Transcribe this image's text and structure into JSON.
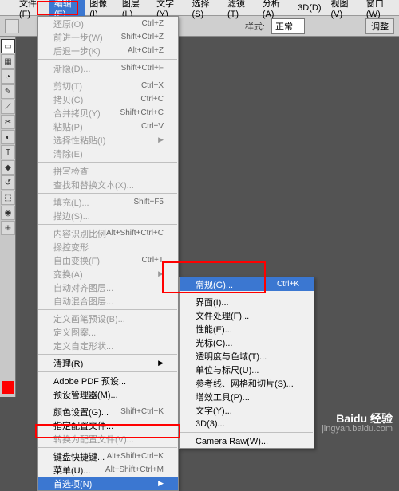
{
  "menubar": {
    "items": [
      "文件(F)",
      "编辑(E)",
      "图像(I)",
      "图层(L)",
      "文字(Y)",
      "选择(S)",
      "滤镜(T)",
      "分析(A)",
      "3D(D)",
      "视图(V)",
      "窗口(W)"
    ],
    "active_index": 1
  },
  "toolbar": {
    "label_style": "样式:",
    "style_value": "正常",
    "adjust_btn": "调整"
  },
  "edit_menu": {
    "items": [
      {
        "label": "还原(O)",
        "sc": "Ctrl+Z",
        "disabled": true
      },
      {
        "label": "前进一步(W)",
        "sc": "Shift+Ctrl+Z",
        "disabled": true
      },
      {
        "label": "后退一步(K)",
        "sc": "Alt+Ctrl+Z",
        "disabled": true
      },
      {
        "sep": true
      },
      {
        "label": "渐隐(D)...",
        "sc": "Shift+Ctrl+F",
        "disabled": true
      },
      {
        "sep": true
      },
      {
        "label": "剪切(T)",
        "sc": "Ctrl+X",
        "disabled": true
      },
      {
        "label": "拷贝(C)",
        "sc": "Ctrl+C",
        "disabled": true
      },
      {
        "label": "合并拷贝(Y)",
        "sc": "Shift+Ctrl+C",
        "disabled": true
      },
      {
        "label": "粘贴(P)",
        "sc": "Ctrl+V",
        "disabled": true
      },
      {
        "label": "选择性粘贴(I)",
        "arrow": true,
        "disabled": true
      },
      {
        "label": "清除(E)",
        "disabled": true
      },
      {
        "sep": true
      },
      {
        "label": "拼写检查",
        "disabled": true
      },
      {
        "label": "查找和替换文本(X)...",
        "disabled": true
      },
      {
        "sep": true
      },
      {
        "label": "填充(L)...",
        "sc": "Shift+F5",
        "disabled": true
      },
      {
        "label": "描边(S)...",
        "disabled": true
      },
      {
        "sep": true
      },
      {
        "label": "内容识别比例",
        "sc": "Alt+Shift+Ctrl+C",
        "disabled": true
      },
      {
        "label": "操控变形",
        "disabled": true
      },
      {
        "label": "自由变换(F)",
        "sc": "Ctrl+T",
        "disabled": true
      },
      {
        "label": "变换(A)",
        "arrow": true,
        "disabled": true
      },
      {
        "label": "自动对齐图层...",
        "disabled": true
      },
      {
        "label": "自动混合图层...",
        "disabled": true
      },
      {
        "sep": true
      },
      {
        "label": "定义画笔预设(B)...",
        "disabled": true
      },
      {
        "label": "定义图案...",
        "disabled": true
      },
      {
        "label": "定义自定形状...",
        "disabled": true
      },
      {
        "sep": true
      },
      {
        "label": "清理(R)",
        "arrow": true
      },
      {
        "sep": true
      },
      {
        "label": "Adobe PDF 预设..."
      },
      {
        "label": "预设管理器(M)..."
      },
      {
        "sep": true
      },
      {
        "label": "颜色设置(G)...",
        "sc": "Shift+Ctrl+K"
      },
      {
        "label": "指定配置文件..."
      },
      {
        "label": "转换为配置文件(V)...",
        "disabled": true
      },
      {
        "sep": true
      },
      {
        "label": "键盘快捷键...",
        "sc": "Alt+Shift+Ctrl+K"
      },
      {
        "label": "菜单(U)...",
        "sc": "Alt+Shift+Ctrl+M"
      },
      {
        "label": "首选项(N)",
        "arrow": true,
        "highlight": true
      }
    ]
  },
  "prefs_submenu": {
    "items": [
      {
        "label": "常规(G)...",
        "sc": "Ctrl+K",
        "highlight": true
      },
      {
        "sep": true
      },
      {
        "label": "界面(I)..."
      },
      {
        "label": "文件处理(F)..."
      },
      {
        "label": "性能(E)..."
      },
      {
        "label": "光标(C)..."
      },
      {
        "label": "透明度与色域(T)..."
      },
      {
        "label": "单位与标尺(U)..."
      },
      {
        "label": "参考线、网格和切片(S)..."
      },
      {
        "label": "增效工具(P)..."
      },
      {
        "label": "文字(Y)..."
      },
      {
        "label": "3D(3)..."
      },
      {
        "sep": true
      },
      {
        "label": "Camera Raw(W)..."
      }
    ]
  },
  "watermark": {
    "brand": "Baidu 经验",
    "url": "jingyan.baidu.com"
  },
  "tool_glyphs": [
    "▭",
    "▦",
    "◔",
    "✎",
    "⟋",
    "✂",
    "◐",
    "T",
    "◆",
    "↺",
    "⬚",
    "◉",
    "⊕",
    "■"
  ]
}
